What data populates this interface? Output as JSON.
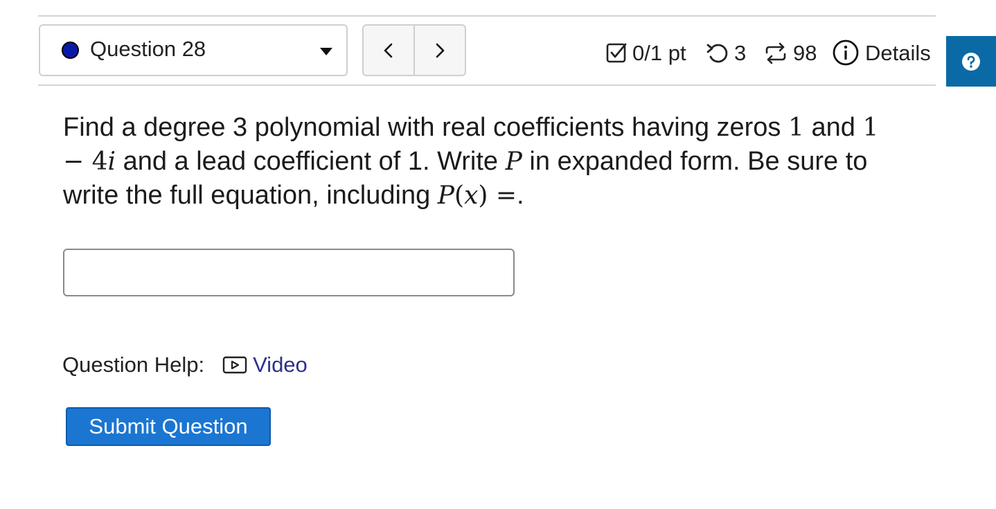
{
  "header": {
    "question_label": "Question 28",
    "score": "0/1 pt",
    "tries": "3",
    "versions": "98",
    "details_label": "Details",
    "status_color": "#0a1aa8"
  },
  "question": {
    "text_1": "Find a degree 3 polynomial with real coefficients having zeros ",
    "zero_1": "1",
    "text_2": " and ",
    "zero_2": "1 − 4",
    "zero_2_i": "i",
    "text_3": " and a lead coefficient of 1. Write ",
    "var_p": "P",
    "text_4": " in expanded form. Be sure to write the full equation, including ",
    "expr_p": "P",
    "expr_paren_open": "(",
    "expr_x": "x",
    "expr_paren_close": ") =",
    "text_5": "."
  },
  "answer": {
    "value": "",
    "placeholder": ""
  },
  "help": {
    "label": "Question Help:",
    "video_label": "Video",
    "link_color": "#2d2f8f"
  },
  "submit": {
    "label": "Submit Question",
    "color": "#1b76d2"
  },
  "colors": {
    "accent": "#0a6aa5"
  }
}
